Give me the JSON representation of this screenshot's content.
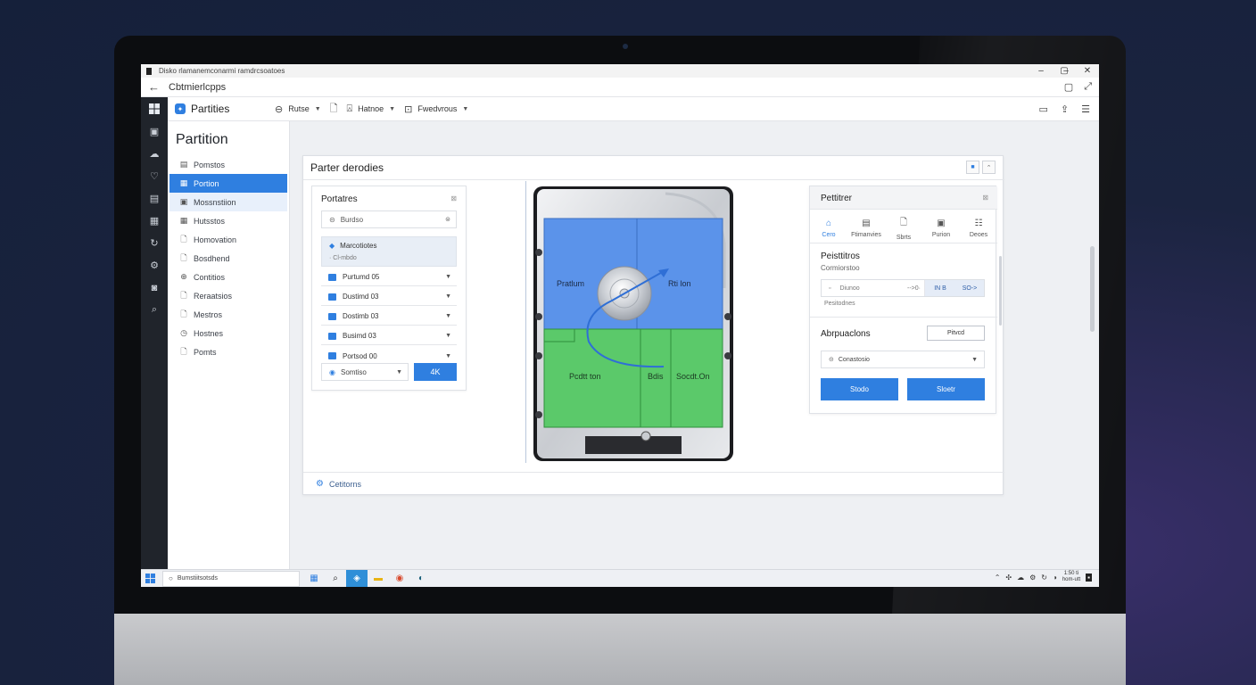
{
  "window": {
    "title": "Disko rlamanemconarmi ramdrcsoatoes",
    "address": "Cbtmierlcpps"
  },
  "toolbar": {
    "app_name": "Partities",
    "items": [
      {
        "label": "Rutse",
        "icon": "disk-icon"
      },
      {
        "label": "",
        "icon": "file-icon"
      },
      {
        "label": "Hatnoe",
        "icon": "user-icon"
      },
      {
        "label": "Fwedvrous",
        "icon": "window-icon"
      }
    ]
  },
  "sidebar": {
    "title": "Partition",
    "items": [
      {
        "label": "Pomstos",
        "icon": "list-icon",
        "state": ""
      },
      {
        "label": "Portion",
        "icon": "grid-icon",
        "state": "active"
      },
      {
        "label": "Mossnstiion",
        "icon": "layers-icon",
        "state": "hover"
      },
      {
        "label": "Hutsstos",
        "icon": "table-icon",
        "state": ""
      },
      {
        "label": "Homovation",
        "icon": "doc-icon",
        "state": ""
      },
      {
        "label": "Bosdhend",
        "icon": "doc-icon",
        "state": ""
      },
      {
        "label": "Contitios",
        "icon": "globe-icon",
        "state": ""
      },
      {
        "label": "Reraatsios",
        "icon": "doc-icon",
        "state": ""
      },
      {
        "label": "Mestros",
        "icon": "doc-icon",
        "state": ""
      },
      {
        "label": "Hostnes",
        "icon": "clock-icon",
        "state": ""
      },
      {
        "label": "Pomts",
        "icon": "doc-icon",
        "state": ""
      }
    ]
  },
  "card": {
    "title": "Parter derodies",
    "footer": "Cetitorns"
  },
  "left_panel": {
    "title": "Portatres",
    "search_placeholder": "Burdso",
    "group_label": "Marcotiotes",
    "group_sub": "· Cl-mbdo",
    "rows": [
      "Purtumd 05",
      "Dustimd 03",
      "Dostimb 03",
      "Busimd 03",
      "Portsod 00"
    ],
    "bottom_select": "Somtiso",
    "ok_button": "4K"
  },
  "disk": {
    "labels": {
      "top_left": "Pratlum",
      "top_right": "Rti lon",
      "bottom_left": "Pcdtt ton",
      "bottom_mid": "Bdis",
      "bottom_right": "Socdt.On"
    },
    "colors": {
      "top": "#5b93ea",
      "bottom": "#5bc96a"
    }
  },
  "right_panel": {
    "title": "Pettitrer",
    "tabs": [
      {
        "label": "Cero",
        "icon": "home-icon",
        "active": true
      },
      {
        "label": "Ftimanvies",
        "icon": "list-icon",
        "active": false
      },
      {
        "label": "Sbrts",
        "icon": "file-icon",
        "active": false
      },
      {
        "label": "Purion",
        "icon": "monitor-icon",
        "active": false
      },
      {
        "label": "Deoes",
        "icon": "sliders-icon",
        "active": false
      }
    ],
    "section_title": "Peisttitros",
    "section_sub": "Cormiorstoo",
    "field": {
      "value": "Diunoo",
      "arrow": "-->0·",
      "unit": "IN B",
      "size": "SO->"
    },
    "field_sub": "Pesitodnes",
    "apply_title": "Abrpuaclons",
    "apply_button": "Pitvcd",
    "select_value": "Conastosio",
    "button_left": "Stodo",
    "button_right": "Sloetr"
  },
  "taskbar": {
    "search": "Bumstiitsotsds",
    "clock_line1": "1:50 ti",
    "clock_line2": "hom-utt"
  }
}
